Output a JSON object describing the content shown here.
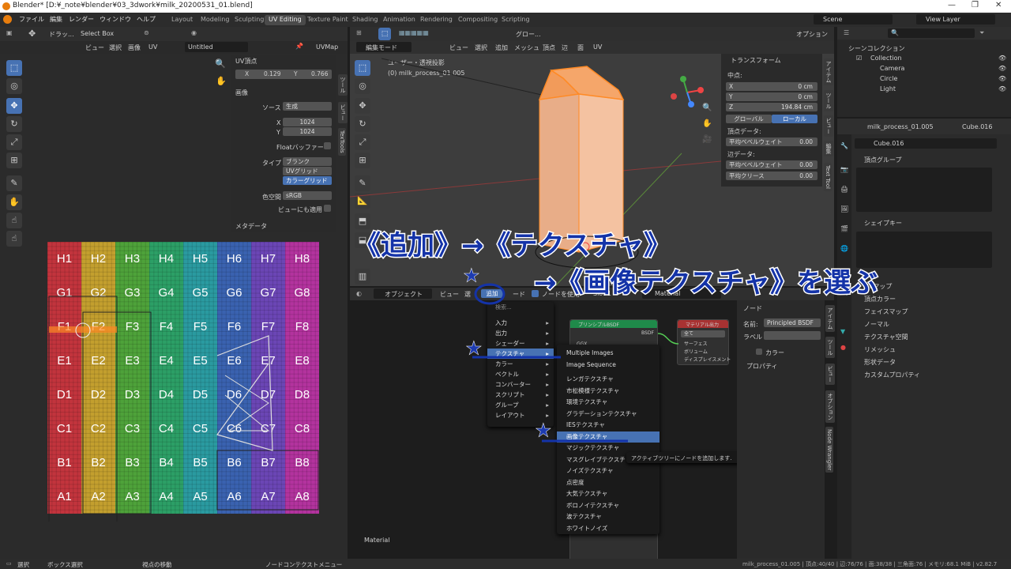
{
  "titlebar": {
    "title": "Blender* [D:¥_note¥blender¥03_3dwork¥milk_20200531_01.blend]"
  },
  "menu": [
    "ファイル",
    "編集",
    "レンダー",
    "ウィンドウ",
    "ヘルプ"
  ],
  "workspaces": [
    "Layout",
    "Modeling",
    "Sculpting",
    "UV Editing",
    "Texture Paint",
    "Shading",
    "Animation",
    "Rendering",
    "Compositing",
    "Scripting"
  ],
  "active_workspace": "UV Editing",
  "scene": {
    "label": "Scene",
    "view_layer": "View Layer"
  },
  "uv_editor": {
    "header": {
      "drag_label": "ドラッ...",
      "select_mode": "Select Box",
      "view": "ビュー",
      "select": "選択",
      "image": "画像",
      "uv": "UV",
      "image_name": "Untitled",
      "uvmap": "UVMap"
    },
    "uv_vertex": {
      "title": "UV頂点",
      "x_label": "X",
      "x": "0.129",
      "y_label": "Y",
      "y": "0.766"
    },
    "image_panel": {
      "title": "画像",
      "source_label": "ソース",
      "source": "生成",
      "x_label": "X",
      "x": "1024",
      "y_label": "Y",
      "y": "1024",
      "float_buffer": "Floatバッファー",
      "type_label": "タイプ",
      "types": [
        "ブランク",
        "UVグリッド",
        "カラーグリッド"
      ],
      "colorspace_label": "色空間",
      "colorspace": "sRGB",
      "view_as_render": "ビューにも適用"
    },
    "metadata": "メタデータ",
    "side_tabs": [
      "ツール",
      "ビュー",
      "TexTools"
    ],
    "grid_rows": [
      [
        "H1",
        "H2",
        "H3",
        "H4",
        "H5",
        "H6",
        "H7",
        "H8"
      ],
      [
        "G1",
        "G2",
        "G3",
        "G4",
        "G5",
        "G6",
        "G7",
        "G8"
      ],
      [
        "F1",
        "F2",
        "F3",
        "F4",
        "F5",
        "F6",
        "F7",
        "F8"
      ],
      [
        "E1",
        "E2",
        "E3",
        "E4",
        "E5",
        "E6",
        "E7",
        "E8"
      ],
      [
        "D1",
        "D2",
        "D3",
        "D4",
        "D5",
        "D6",
        "D7",
        "D8"
      ],
      [
        "C1",
        "C2",
        "C3",
        "C4",
        "C5",
        "C6",
        "C7",
        "C8"
      ],
      [
        "B1",
        "B2",
        "B3",
        "B4",
        "B5",
        "B6",
        "B7",
        "B8"
      ],
      [
        "A1",
        "A2",
        "A3",
        "A4",
        "A5",
        "A6",
        "A7",
        "A8"
      ]
    ],
    "column_colors": [
      "#c2343d",
      "#c39f2e",
      "#4ea23a",
      "#2c9f66",
      "#2a9aa0",
      "#3a62b0",
      "#6b46b5",
      "#b3339e"
    ]
  },
  "viewport": {
    "header": {
      "global": "グロー...",
      "options": "オプション"
    },
    "mode": "編集モード",
    "menus": [
      "ビュー",
      "選択",
      "追加",
      "メッシュ",
      "頂点",
      "辺",
      "面",
      "UV"
    ],
    "overlay_line1": "ユーザー・透視投影",
    "overlay_line2": "(0) milk_process_01.005",
    "transform": {
      "title": "トランスフォーム",
      "median": "中点:",
      "x_label": "X",
      "x": "0 cm",
      "y_label": "Y",
      "y": "0 cm",
      "z_label": "Z",
      "z": "194.84 cm",
      "global": "グローバル",
      "local": "ローカル",
      "vertex_data": "頂点データ:",
      "vertex_bevel": "平均ベベルウェイト",
      "vertex_bevel_val": "0.00",
      "edge_data": "辺データ:",
      "edge_bevel": "平均ベベルウェイト",
      "edge_bevel_val": "0.00",
      "crease": "平均クリース",
      "crease_val": "0.00"
    },
    "side_tabs": [
      "アイテム",
      "ツール",
      "ビュー",
      "編集",
      "Text Tool"
    ]
  },
  "node_editor": {
    "object": "オブジェクト",
    "menus": [
      "ビュー",
      "選",
      "追加",
      "ード"
    ],
    "use_nodes": "ノードを使用",
    "slot": "Slot 1",
    "material": "Material",
    "footer_label": "Material",
    "side_tabs": [
      "アイテム",
      "ツール",
      "ビュー",
      "オプション",
      "Node Wrangler"
    ],
    "add_menu": {
      "partial_top": "検索...",
      "items": [
        "入力",
        "出力",
        "シェーダー",
        "テクスチャ",
        "カラー",
        "ベクトル",
        "コンバーター",
        "スクリプト",
        "グループ",
        "レイアウト"
      ],
      "highlighted": "テクスチャ"
    },
    "texture_submenu": {
      "items": [
        "Multiple Images",
        "Image Sequence",
        "レンガテクスチャ",
        "市松模様テクスチャ",
        "環境テクスチャ",
        "グラデーションテクスチャ",
        "IESテクスチャ",
        "画像テクスチャ",
        "マジックテクスチャ",
        "マスグレイブテクスチャ",
        "ノイズテクスチャ",
        "点密度",
        "大気テクスチャ",
        "ボロノイテクスチャ",
        "波テクスチャ",
        "ホワイトノイズ"
      ],
      "highlighted": "画像テクスチャ"
    },
    "tooltip": "アクティブツリーにノードを追加します.",
    "bsdf_node": {
      "title": "プリンシプルBSDF",
      "output": "BSDF",
      "dist": "GGX"
    },
    "output_node": {
      "title": "マテリアル出力",
      "target": "全て",
      "sockets": [
        "サーフェス",
        "ボリューム",
        "ディスプレイスメント"
      ]
    },
    "node_panel": {
      "title": "ノード",
      "name_label": "名前:",
      "name": "Principled BSDF",
      "label_label": "ラベル",
      "color": "カラー",
      "properties": "プロパティ"
    }
  },
  "outliner": {
    "scene_collection": "シーンコレクション",
    "items": [
      "Collection",
      "Camera",
      "Circle",
      "Light"
    ]
  },
  "properties": {
    "object": "milk_process_01.005",
    "mesh": "Cube.016",
    "data_name": "Cube.016",
    "sections": [
      "頂点グループ",
      "シェイプキー",
      "UVマップ",
      "頂点カラー",
      "フェイスマップ",
      "ノーマル",
      "テクスチャ空間",
      "リメッシュ",
      "形状データ",
      "カスタムプロパティ"
    ]
  },
  "annotations": {
    "line1": "《追加》→《テクスチャ》",
    "line2": "→《画像テクスチャ》を選ぶ",
    "star": "★"
  },
  "statusbar": {
    "select": "選択",
    "box_select": "ボックス選択",
    "view_move": "視点の移動",
    "node_menu": "ノードコンテクストメニュー",
    "stats": "milk_process_01.005 | 頂点:40/40 | 辺:76/76 | 面:38/38 | 三角面:76 | メモリ:68.1 MiB | v2.82.7"
  },
  "colors": {
    "accent": "#4772b3",
    "orange": "#ff8a25",
    "annotation": "#1433a8"
  }
}
